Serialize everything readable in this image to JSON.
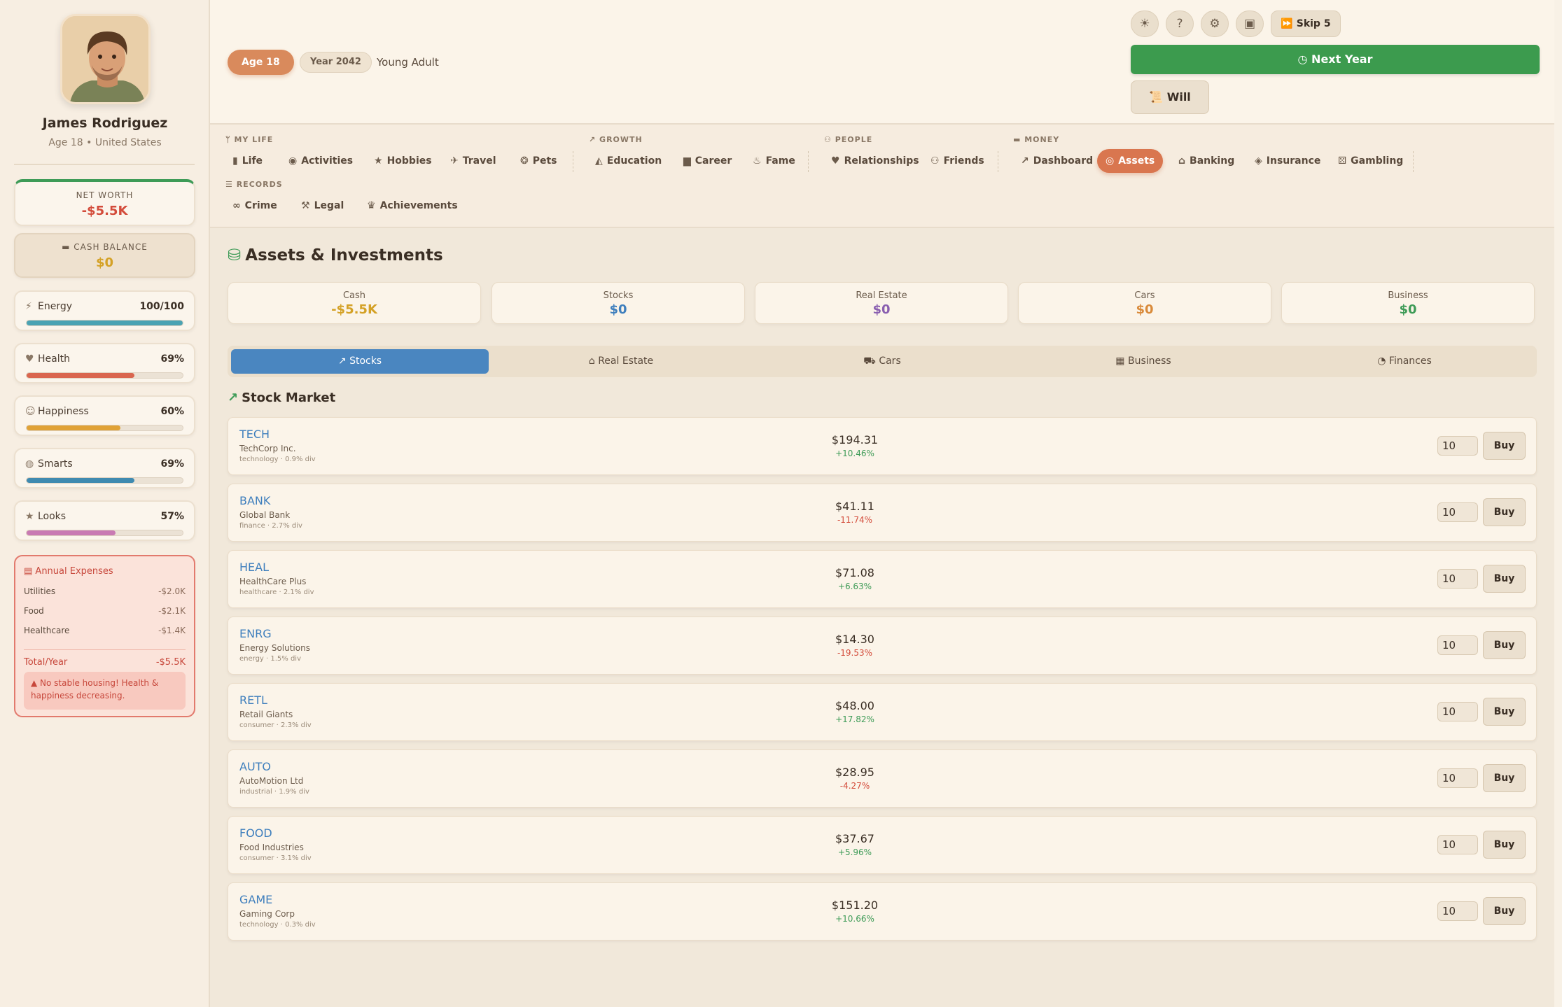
{
  "character": {
    "name": "James Rodriguez",
    "subtitle": "Age 18 • United States"
  },
  "net_worth": {
    "label": "NET WORTH",
    "value": "-$5.5K"
  },
  "cash_balance": {
    "label": "CASH BALANCE",
    "value": "$0"
  },
  "stats": [
    {
      "name": "Energy",
      "value": "100/100",
      "level": 1.0,
      "color": "#4aa3b3",
      "icon": "bolt-icon"
    },
    {
      "name": "Health",
      "value": "69%",
      "level": 0.69,
      "color": "#d9664f",
      "icon": "heart-icon"
    },
    {
      "name": "Happiness",
      "value": "60%",
      "level": 0.6,
      "color": "#e0a236",
      "icon": "smile-icon"
    },
    {
      "name": "Smarts",
      "value": "69%",
      "level": 0.69,
      "color": "#3f8ab0",
      "icon": "brain-icon"
    },
    {
      "name": "Looks",
      "value": "57%",
      "level": 0.57,
      "color": "#c97ab3",
      "icon": "star-icon"
    }
  ],
  "expenses": {
    "title": "Annual Expenses",
    "items": [
      {
        "label": "Utilities",
        "amount": "-$2.0K"
      },
      {
        "label": "Food",
        "amount": "-$2.1K"
      },
      {
        "label": "Healthcare",
        "amount": "-$1.4K"
      }
    ],
    "total_label": "Total/Year",
    "total_amount": "-$5.5K",
    "warning": "No stable housing! Health & happiness decreasing."
  },
  "header": {
    "age": "Age 18",
    "year": "Year 2042",
    "stage": "Young Adult",
    "skip_label": "Skip 5",
    "next_year_label": "Next Year",
    "will_label": "Will"
  },
  "nav": {
    "groups": {
      "my_life": "MY LIFE",
      "growth": "GROWTH",
      "people": "PEOPLE",
      "money": "MONEY",
      "records": "RECORDS"
    },
    "items": {
      "life": "Life",
      "activities": "Activities",
      "hobbies": "Hobbies",
      "travel": "Travel",
      "pets": "Pets",
      "education": "Education",
      "career": "Career",
      "fame": "Fame",
      "relationships": "Relationships",
      "friends": "Friends",
      "dashboard": "Dashboard",
      "assets": "Assets",
      "banking": "Banking",
      "insurance": "Insurance",
      "gambling": "Gambling",
      "crime": "Crime",
      "legal": "Legal",
      "achievements": "Achievements"
    },
    "active": "Assets"
  },
  "assets": {
    "title": "Assets & Investments",
    "summary": [
      {
        "label": "Cash",
        "value": "-$5.5K",
        "color": "#d4a126"
      },
      {
        "label": "Stocks",
        "value": "$0",
        "color": "#3f7fbd"
      },
      {
        "label": "Real Estate",
        "value": "$0",
        "color": "#8a5fb0"
      },
      {
        "label": "Cars",
        "value": "$0",
        "color": "#d98a3a"
      },
      {
        "label": "Business",
        "value": "$0",
        "color": "#3e9b57"
      }
    ],
    "tabs": [
      "Stocks",
      "Real Estate",
      "Cars",
      "Business",
      "Finances"
    ],
    "active_tab": "Stocks",
    "stock_market_title": "Stock Market",
    "buy_label": "Buy",
    "stocks": [
      {
        "symbol": "TECH",
        "company": "TechCorp Inc.",
        "meta": "technology · 0.9% div",
        "price": "$194.31",
        "change": "+10.46%",
        "direction": "up",
        "qty": "10"
      },
      {
        "symbol": "BANK",
        "company": "Global Bank",
        "meta": "finance · 2.7% div",
        "price": "$41.11",
        "change": "-11.74%",
        "direction": "down",
        "qty": "10"
      },
      {
        "symbol": "HEAL",
        "company": "HealthCare Plus",
        "meta": "healthcare · 2.1% div",
        "price": "$71.08",
        "change": "+6.63%",
        "direction": "up",
        "qty": "10"
      },
      {
        "symbol": "ENRG",
        "company": "Energy Solutions",
        "meta": "energy · 1.5% div",
        "price": "$14.30",
        "change": "-19.53%",
        "direction": "down",
        "qty": "10"
      },
      {
        "symbol": "RETL",
        "company": "Retail Giants",
        "meta": "consumer · 2.3% div",
        "price": "$48.00",
        "change": "+17.82%",
        "direction": "up",
        "qty": "10"
      },
      {
        "symbol": "AUTO",
        "company": "AutoMotion Ltd",
        "meta": "industrial · 1.9% div",
        "price": "$28.95",
        "change": "-4.27%",
        "direction": "down",
        "qty": "10"
      },
      {
        "symbol": "FOOD",
        "company": "Food Industries",
        "meta": "consumer · 3.1% div",
        "price": "$37.67",
        "change": "+5.96%",
        "direction": "up",
        "qty": "10"
      },
      {
        "symbol": "GAME",
        "company": "Gaming Corp",
        "meta": "technology · 0.3% div",
        "price": "$151.20",
        "change": "+10.66%",
        "direction": "up",
        "qty": "10"
      }
    ]
  }
}
